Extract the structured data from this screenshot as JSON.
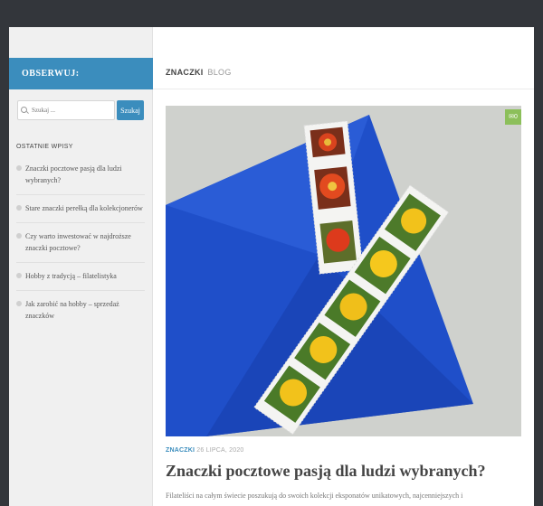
{
  "sidebar": {
    "follow_label": "OBSERWUJ:",
    "search": {
      "placeholder": "Szukaj ...",
      "button_label": "Szukaj"
    },
    "recent_title": "OSTATNIE WPISY",
    "recent_posts": [
      "Znaczki pocztowe pasją dla ludzi wybranych?",
      "Stare znaczki perełką dla kolekcjonerów",
      "Czy warto inwestować w najdroższe znaczki pocztowe?",
      "Hobby z tradycją – filatelistyka",
      "Jak zarobić na hobby – sprzedaż znaczków"
    ]
  },
  "header": {
    "blog_name": "ZNACZKI",
    "blog_suffix": "BLOG"
  },
  "post": {
    "comment_count": "0",
    "category": "ZNACZKI",
    "date": "26 LIPCA, 2020",
    "title": "Znaczki pocztowe pasją dla ludzi wybranych?",
    "excerpt": "Filateliści na całym świecie poszukują do swoich kolekcji eksponatów unikatowych, najcenniejszych i"
  },
  "colors": {
    "accent": "#3b8dbd",
    "badge": "#8cbf5a",
    "envelope": "#1f4fc9"
  }
}
